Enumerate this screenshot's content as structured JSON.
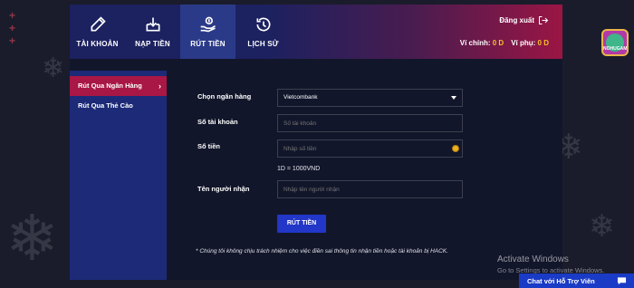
{
  "nav": {
    "items": [
      {
        "label": "TÀI KHOẢN",
        "icon": "pencil-icon"
      },
      {
        "label": "NẠP TIỀN",
        "icon": "deposit-tray-icon"
      },
      {
        "label": "RÚT TIỀN",
        "icon": "withdraw-hand-icon"
      },
      {
        "label": "LỊCH SỬ",
        "icon": "history-icon"
      }
    ],
    "active_index": 2,
    "logout_label": "Đăng xuất",
    "main_balance_label": "Ví chính:",
    "main_balance_value": "0 D",
    "sub_balance_label": "Ví phụ:",
    "sub_balance_value": "0 D"
  },
  "sidebar": {
    "items": [
      {
        "label": "Rút Qua Ngân Hàng",
        "active": true
      },
      {
        "label": "Rút Qua Thẻ Cào",
        "active": false
      }
    ]
  },
  "form": {
    "bank_label": "Chọn ngân hàng",
    "bank_selected": "Vietcombank",
    "account_label": "Số tài khoản",
    "account_placeholder": "Số tài khoản",
    "amount_label": "Số tiền",
    "amount_placeholder": "Nhập số tiền",
    "rate_text": "1D = 1000VND",
    "recipient_label": "Tên người nhận",
    "recipient_placeholder": "Nhập tên người nhận",
    "submit_label": "RÚT TIỀN",
    "note": "* Chúng tôi không chịu trách nhiệm cho việc điền sai thông tin nhận tiền hoặc tài khoản bị HACK."
  },
  "badge": {
    "text": "NOHUGAME"
  },
  "watermark": {
    "line1": "Activate Windows",
    "line2": "Go to Settings to activate Windows."
  },
  "chat": {
    "label": "Chat với Hỗ Trợ Viên",
    "icon": "chat-bubble-icon"
  },
  "colors": {
    "accent_red": "#a81745",
    "nav_active": "#2b3a88",
    "sidebar_bg": "#1c2a78",
    "button_blue": "#2236c8",
    "balance_yellow": "#f5c02a",
    "chat_blue": "#1a3bc6"
  }
}
